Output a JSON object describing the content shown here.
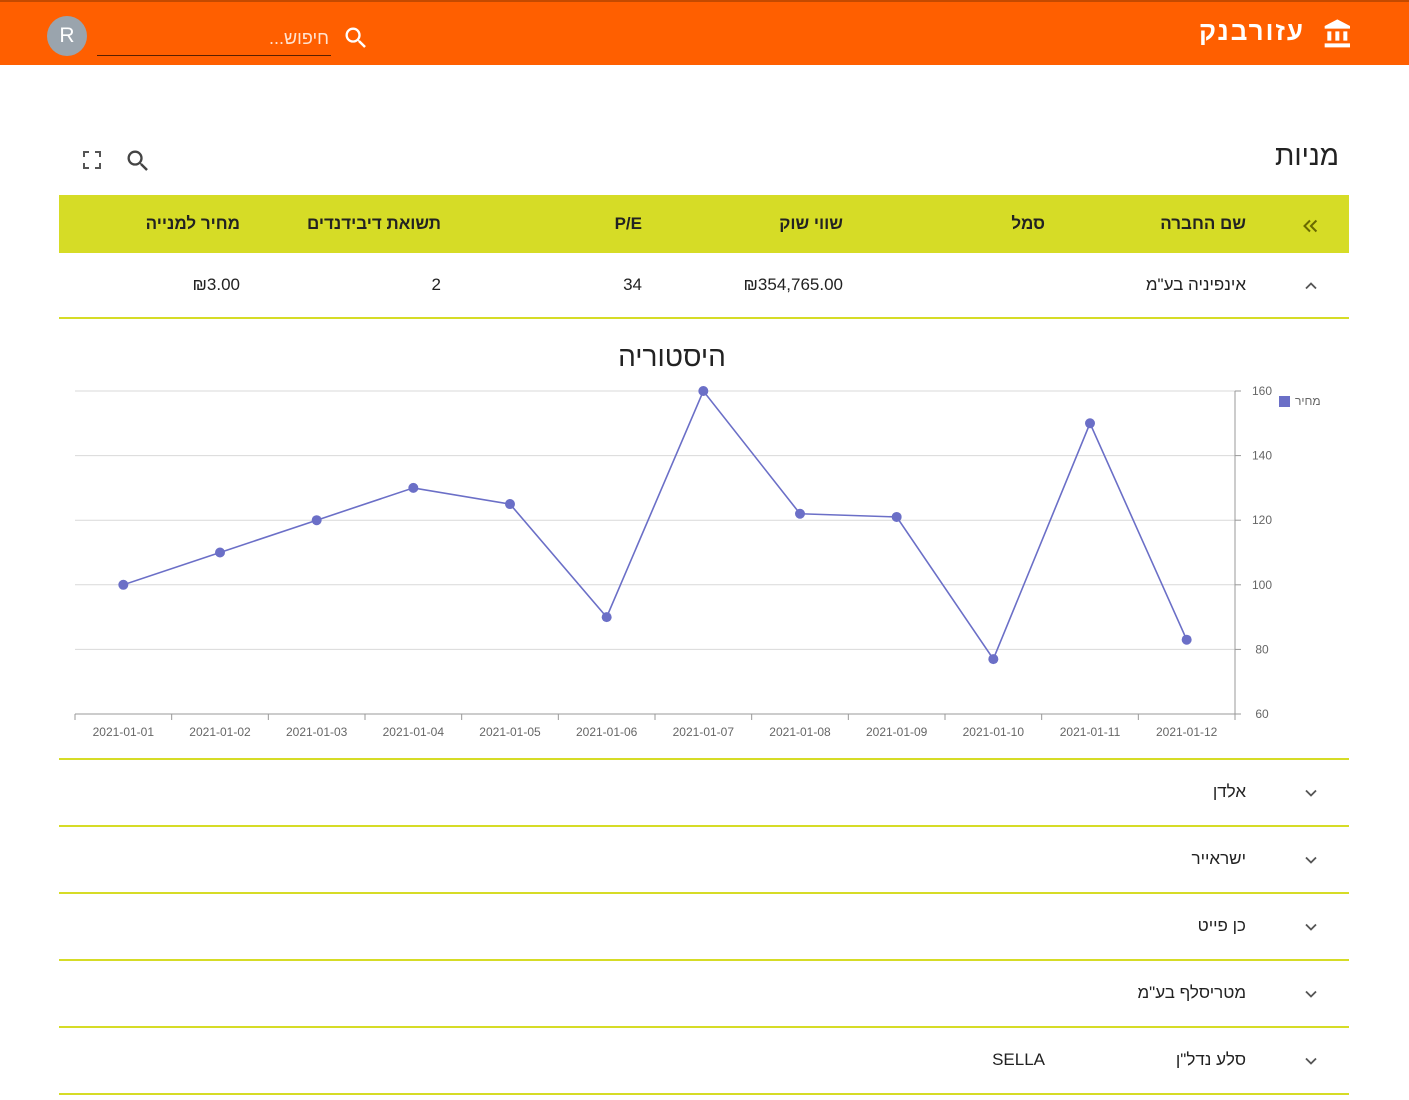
{
  "header": {
    "brand_name": "עזורבנק",
    "search_placeholder": "חיפוש...",
    "avatar_initial": "R"
  },
  "colors": {
    "appbar": "#ff5f00",
    "table_header": "#d6dc26",
    "series": "#6b6fc7"
  },
  "page": {
    "title": "מניות"
  },
  "table": {
    "columns": [
      "שם החברה",
      "סמל",
      "שווי שוק",
      "P/E",
      "תשואת דיבידנדים",
      "מחיר למנייה"
    ],
    "rows": [
      {
        "name": "אינפיניה בע\"מ",
        "symbol": "",
        "market_cap": "₪354,765.00",
        "pe": "34",
        "dividend_yield": "2",
        "price": "₪3.00",
        "expanded": true
      },
      {
        "name": "אלדן",
        "symbol": "",
        "market_cap": "",
        "pe": "",
        "dividend_yield": "",
        "price": "",
        "expanded": false
      },
      {
        "name": "ישראייר",
        "symbol": "",
        "market_cap": "",
        "pe": "",
        "dividend_yield": "",
        "price": "",
        "expanded": false
      },
      {
        "name": "כן פייט",
        "symbol": "",
        "market_cap": "",
        "pe": "",
        "dividend_yield": "",
        "price": "",
        "expanded": false
      },
      {
        "name": "מטריסלף בע\"מ",
        "symbol": "",
        "market_cap": "",
        "pe": "",
        "dividend_yield": "",
        "price": "",
        "expanded": false
      },
      {
        "name": "סלע נדל\"ן",
        "symbol": "SELLA",
        "market_cap": "",
        "pe": "",
        "dividend_yield": "",
        "price": "",
        "expanded": false
      }
    ]
  },
  "chart_data": {
    "type": "line",
    "title": "היסטוריה",
    "x": [
      "2021-01-01",
      "2021-01-02",
      "2021-01-03",
      "2021-01-04",
      "2021-01-05",
      "2021-01-06",
      "2021-01-07",
      "2021-01-08",
      "2021-01-09",
      "2021-01-10",
      "2021-01-11",
      "2021-01-12"
    ],
    "series": [
      {
        "name": "מחיר",
        "values": [
          100,
          110,
          120,
          130,
          125,
          90,
          160,
          122,
          121,
          77,
          150,
          83
        ]
      }
    ],
    "ylim": [
      60,
      160
    ],
    "yticks": [
      60,
      80,
      100,
      120,
      140,
      160
    ],
    "y_axis_side": "right",
    "grid": true,
    "legend": "top-right"
  }
}
